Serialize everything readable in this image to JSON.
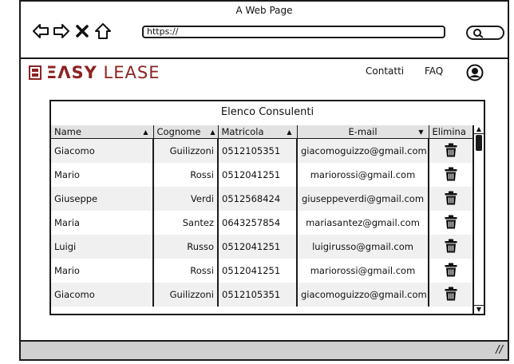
{
  "window": {
    "title": "A Web Page"
  },
  "browser": {
    "url": "https://"
  },
  "site": {
    "logo_bold": "ΞΛSY",
    "logo_light": " LEASE",
    "nav": [
      "Contatti",
      "FAQ"
    ]
  },
  "panel": {
    "title": "Elenco Consulenti"
  },
  "table": {
    "headers": [
      "Name",
      "Cognome",
      "Matricola",
      "E-mail",
      "Elimina"
    ],
    "rows": [
      [
        "Giacomo",
        "Guilizzoni",
        "0512105351",
        "giacomoguizzo@gmail.com"
      ],
      [
        "Mario",
        "Rossi",
        "0512041251",
        "mariorossi@gmail.com"
      ],
      [
        "Giuseppe",
        "Verdi",
        "0512568424",
        "giuseppeverdi@gmail.com"
      ],
      [
        "Maria",
        "Santez",
        "0643257854",
        "mariasantez@gmail.com"
      ],
      [
        "Luigi",
        "Russo",
        "0512041251",
        "luigirusso@gmail.com"
      ],
      [
        "Mario",
        "Rossi",
        "0512041251",
        "mariorossi@gmail.com"
      ],
      [
        "Giacomo",
        "Guilizzoni",
        "0512105351",
        "giacomoguizzo@gmail.com"
      ]
    ]
  },
  "colors": {
    "brand": "#8e2222",
    "header_bg": "#e2e2e2",
    "status_bg": "#d0d0d0"
  }
}
